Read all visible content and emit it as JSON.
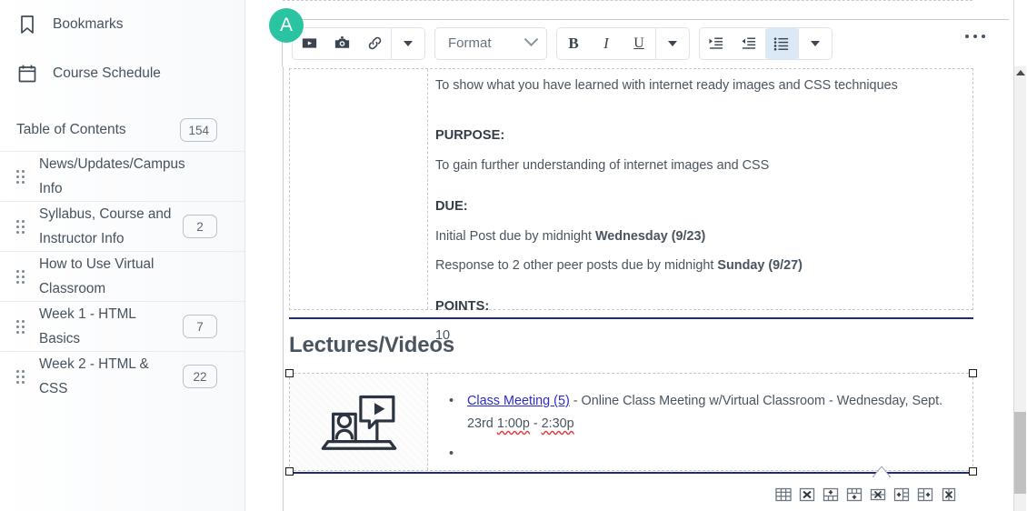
{
  "sidebar": {
    "nav": [
      {
        "label": "Bookmarks",
        "icon": "bookmark-icon"
      },
      {
        "label": "Course Schedule",
        "icon": "calendar-icon"
      }
    ],
    "toc": {
      "title": "Table of Contents",
      "count": "154",
      "items": [
        {
          "label": "News/Updates/Campus Info",
          "count": ""
        },
        {
          "label": "Syllabus, Course and Instructor Info",
          "count": "2"
        },
        {
          "label": "How to Use Virtual Classroom",
          "count": ""
        },
        {
          "label": "Week 1 - HTML Basics",
          "count": "7"
        },
        {
          "label": "Week 2 - HTML & CSS",
          "count": "22"
        }
      ]
    }
  },
  "badge": {
    "letter": "A",
    "color": "#2bc4a2"
  },
  "toolbar": {
    "insert_group": [
      {
        "name": "insert-video-button",
        "icon": "video-icon"
      },
      {
        "name": "insert-image-button",
        "icon": "camera-icon"
      },
      {
        "name": "insert-link-button",
        "icon": "link-icon"
      },
      {
        "name": "insert-more-button",
        "icon": "caret-down-icon"
      }
    ],
    "format_select": {
      "label": "Format",
      "icon": "chevron-down-icon"
    },
    "style_group": [
      {
        "name": "bold-button",
        "label": "B"
      },
      {
        "name": "italic-button",
        "label": "I"
      },
      {
        "name": "underline-button",
        "label": "U"
      },
      {
        "name": "style-more-button",
        "icon": "caret-down-icon"
      }
    ],
    "list_group": [
      {
        "name": "indent-increase-button",
        "icon": "indent-increase-icon"
      },
      {
        "name": "indent-decrease-button",
        "icon": "indent-decrease-icon"
      },
      {
        "name": "bullet-list-button",
        "icon": "bullet-list-icon",
        "active": true
      },
      {
        "name": "list-more-button",
        "icon": "caret-down-icon"
      }
    ],
    "overflow": {
      "name": "overflow-menu-button",
      "icon": "ellipsis-icon"
    }
  },
  "document": {
    "intro": "To show what you have learned with internet ready images and CSS techniques",
    "purpose_heading": "PURPOSE:",
    "purpose_text": "To gain further understanding of internet images and CSS",
    "due_heading": "DUE:",
    "due_line1_plain": "Initial Post due by midnight ",
    "due_line1_bold": "Wednesday (9/23)",
    "due_line2_plain": "Response to 2 other peer posts due by midnight ",
    "due_line2_bold": "Sunday (9/27)",
    "points_heading": "POINTS:",
    "points_value": "10",
    "section_heading": "Lectures/Videos",
    "media_icon": "online-class-laptop-icon",
    "list_item": {
      "link_text": "Class Meeting (5)",
      "rest_text": " - Online Class Meeting w/Virtual Classroom - Wednesday, Sept. 23rd ",
      "time_start": "1:00p",
      "time_dash": " - ",
      "time_end": "2:30p"
    },
    "empty_bullet": ""
  },
  "table_toolbar": [
    {
      "name": "table-properties-button",
      "icon": "table-grid-icon"
    },
    {
      "name": "delete-table-button",
      "icon": "table-delete-icon"
    },
    {
      "name": "insert-row-before-button",
      "icon": "row-insert-before-icon"
    },
    {
      "name": "insert-row-after-button",
      "icon": "row-insert-after-icon"
    },
    {
      "name": "delete-row-button",
      "icon": "row-delete-icon"
    },
    {
      "name": "insert-column-before-button",
      "icon": "column-insert-before-icon"
    },
    {
      "name": "insert-column-after-button",
      "icon": "column-insert-after-icon"
    },
    {
      "name": "delete-column-button",
      "icon": "column-delete-icon"
    }
  ]
}
